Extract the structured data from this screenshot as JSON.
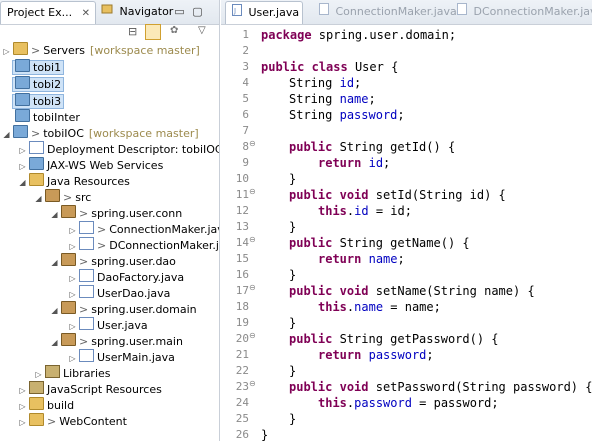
{
  "left_tabs": [
    {
      "label": "Project Ex...",
      "active": true
    },
    {
      "label": "Navigator",
      "active": false
    }
  ],
  "editor_tabs": [
    {
      "label": "User.java",
      "active": true
    },
    {
      "label": "ConnectionMaker.java",
      "active": false
    },
    {
      "label": "DConnectionMaker.java",
      "active": false
    }
  ],
  "tree": {
    "servers": {
      "prefix": ">",
      "label": "Servers",
      "ws": "[workspace master]"
    },
    "tobi1": "tobi1",
    "tobi2": "tobi2",
    "tobi3": "tobi3",
    "tobiInter": "tobiInter",
    "tobiIOC": {
      "prefix": ">",
      "label": "tobiIOC",
      "ws": "[workspace master]"
    },
    "deployment": "Deployment Descriptor: tobiIOC",
    "jaxws": "JAX-WS Web Services",
    "java_resources": "Java Resources",
    "src": {
      "prefix": ">",
      "label": "src"
    },
    "pkg_conn": {
      "prefix": ">",
      "label": "spring.user.conn"
    },
    "conn_maker": {
      "prefix": ">",
      "label": "ConnectionMaker.java"
    },
    "dconn_maker": {
      "prefix": ">",
      "label": "DConnectionMaker.java"
    },
    "pkg_dao": {
      "prefix": ">",
      "label": "spring.user.dao"
    },
    "dao_factory": "DaoFactory.java",
    "user_dao": "UserDao.java",
    "pkg_domain": {
      "prefix": ">",
      "label": "spring.user.domain"
    },
    "user_java": "User.java",
    "pkg_main": {
      "prefix": ">",
      "label": "spring.user.main"
    },
    "user_main": "UserMain.java",
    "libraries": "Libraries",
    "js_resources": "JavaScript Resources",
    "build": "build",
    "webcontent": {
      "prefix": ">",
      "label": "WebContent"
    }
  },
  "code": {
    "l1a": "package",
    "l1b": " spring.user.domain;",
    "l3a": "public",
    "l3b": " ",
    "l3c": "class",
    "l3d": " User {",
    "l4a": "String",
    "l4b": " ",
    "l4c": "id",
    "l4d": ";",
    "l5a": "String",
    "l5b": " ",
    "l5c": "name",
    "l5d": ";",
    "l6a": "String",
    "l6b": " ",
    "l6c": "password",
    "l6d": ";",
    "l8a": "public",
    "l8b": " String getId() {",
    "l9a": "return",
    "l9b": " ",
    "l9c": "id",
    "l9d": ";",
    "l10": "}",
    "l11a": "public",
    "l11b": " ",
    "l11c": "void",
    "l11d": " setId(String id) {",
    "l12a": "this",
    "l12b": ".",
    "l12c": "id",
    "l12d": " = id;",
    "l13": "}",
    "l14a": "public",
    "l14b": " String getName() {",
    "l15a": "return",
    "l15b": " ",
    "l15c": "name",
    "l15d": ";",
    "l16": "}",
    "l17a": "public",
    "l17b": " ",
    "l17c": "void",
    "l17d": " setName(String name) {",
    "l18a": "this",
    "l18b": ".",
    "l18c": "name",
    "l18d": " = name;",
    "l19": "}",
    "l20a": "public",
    "l20b": " String getPassword() {",
    "l21a": "return",
    "l21b": " ",
    "l21c": "password",
    "l21d": ";",
    "l22": "}",
    "l23a": "public",
    "l23b": " ",
    "l23c": "void",
    "l23d": " setPassword(String password) {",
    "l24a": "this",
    "l24b": ".",
    "l24c": "password",
    "l24d": " = password;",
    "l25": "}",
    "l26": "}"
  },
  "line_numbers": [
    "1",
    "2",
    "3",
    "4",
    "5",
    "6",
    "7",
    "8",
    "9",
    "10",
    "11",
    "12",
    "13",
    "14",
    "15",
    "16",
    "17",
    "18",
    "19",
    "20",
    "21",
    "22",
    "23",
    "24",
    "25",
    "26"
  ],
  "colors": {
    "keyword": "#7f0055",
    "field": "#0000c0",
    "selection": "#cfe3f7"
  }
}
